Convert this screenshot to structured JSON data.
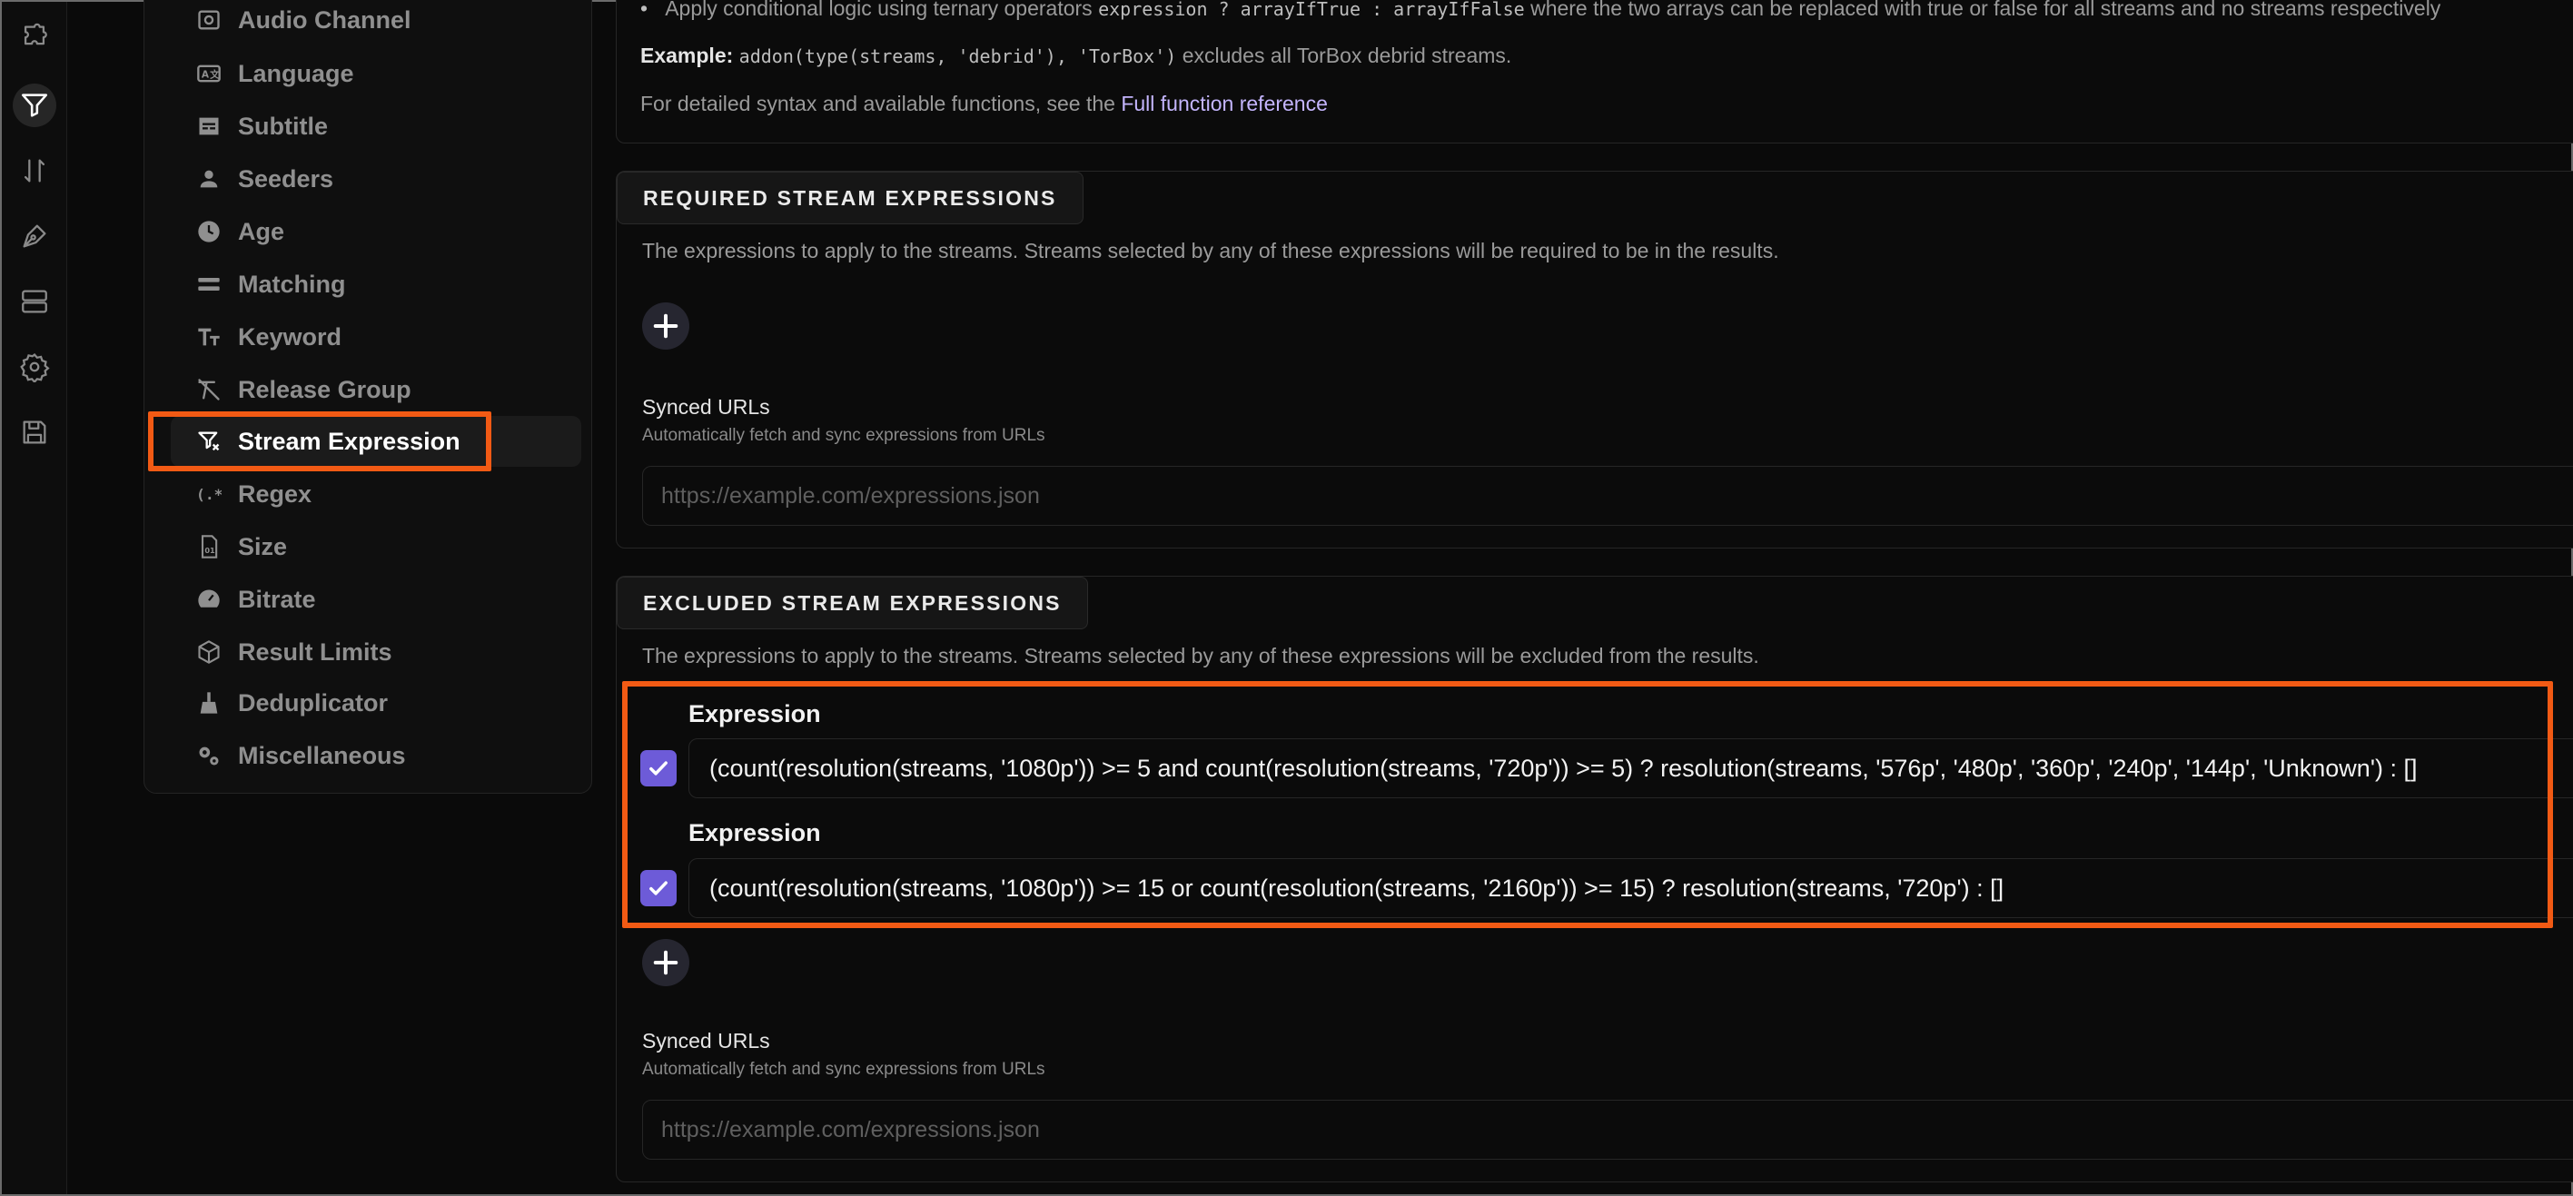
{
  "rail": {
    "items": [
      {
        "name": "addons-icon",
        "active": false
      },
      {
        "name": "filter-icon",
        "active": true
      },
      {
        "name": "sort-icon",
        "active": false
      },
      {
        "name": "pen-icon",
        "active": false
      },
      {
        "name": "server-icon",
        "active": false
      },
      {
        "name": "gear-icon",
        "active": false
      },
      {
        "name": "save-icon",
        "active": false
      }
    ]
  },
  "sidebar": {
    "items": [
      {
        "label": "Audio Channel",
        "icon": "audio-channel-icon"
      },
      {
        "label": "Language",
        "icon": "language-icon"
      },
      {
        "label": "Subtitle",
        "icon": "subtitle-icon"
      },
      {
        "label": "Seeders",
        "icon": "person-icon"
      },
      {
        "label": "Age",
        "icon": "clock-icon"
      },
      {
        "label": "Matching",
        "icon": "equals-icon"
      },
      {
        "label": "Keyword",
        "icon": "text-icon"
      },
      {
        "label": "Release Group",
        "icon": "release-group-icon"
      },
      {
        "label": "Stream Expression",
        "icon": "filter-expression-icon",
        "active": true
      },
      {
        "label": "Regex",
        "icon": "regex-icon"
      },
      {
        "label": "Size",
        "icon": "file-size-icon"
      },
      {
        "label": "Bitrate",
        "icon": "gauge-icon"
      },
      {
        "label": "Result Limits",
        "icon": "box-icon"
      },
      {
        "label": "Deduplicator",
        "icon": "broom-icon"
      },
      {
        "label": "Miscellaneous",
        "icon": "gears-icon"
      }
    ]
  },
  "intro": {
    "bullet_prefix": "Apply conditional logic using ternary operators",
    "bullet_code": "expression ? arrayIfTrue : arrayIfFalse",
    "bullet_suffix": "where the two arrays can be replaced with true or false for all streams and no streams respectively",
    "example_label": "Example:",
    "example_code": "addon(type(streams, 'debrid'), 'TorBox')",
    "example_suffix": "excludes all TorBox debrid streams.",
    "reference_prefix": "For detailed syntax and available functions, see the",
    "reference_link": "Full function reference"
  },
  "required": {
    "title": "REQUIRED STREAM EXPRESSIONS",
    "description": "The expressions to apply to the streams. Streams selected by any of these expressions will be required to be in the results.",
    "synced_label": "Synced URLs",
    "synced_help": "Automatically fetch and sync expressions from URLs",
    "url_placeholder": "https://example.com/expressions.json"
  },
  "excluded": {
    "title": "EXCLUDED STREAM EXPRESSIONS",
    "description": "The expressions to apply to the streams. Streams selected by any of these expressions will be excluded from the results.",
    "expressions": [
      {
        "label": "Expression",
        "enabled": true,
        "value": "(count(resolution(streams, '1080p')) >= 5 and count(resolution(streams, '720p')) >= 5) ? resolution(streams, '576p', '480p', '360p', '240p', '144p', 'Unknown') : []"
      },
      {
        "label": "Expression",
        "enabled": true,
        "value": "(count(resolution(streams, '1080p')) >= 15 or count(resolution(streams, '2160p')) >= 15) ? resolution(streams, '720p') : []"
      }
    ],
    "synced_label": "Synced URLs",
    "synced_help": "Automatically fetch and sync expressions from URLs",
    "url_placeholder": "https://example.com/expressions.json"
  },
  "colors": {
    "accent": "#6d5bd8",
    "link": "#c4b5fd",
    "highlight": "#f25a14"
  }
}
